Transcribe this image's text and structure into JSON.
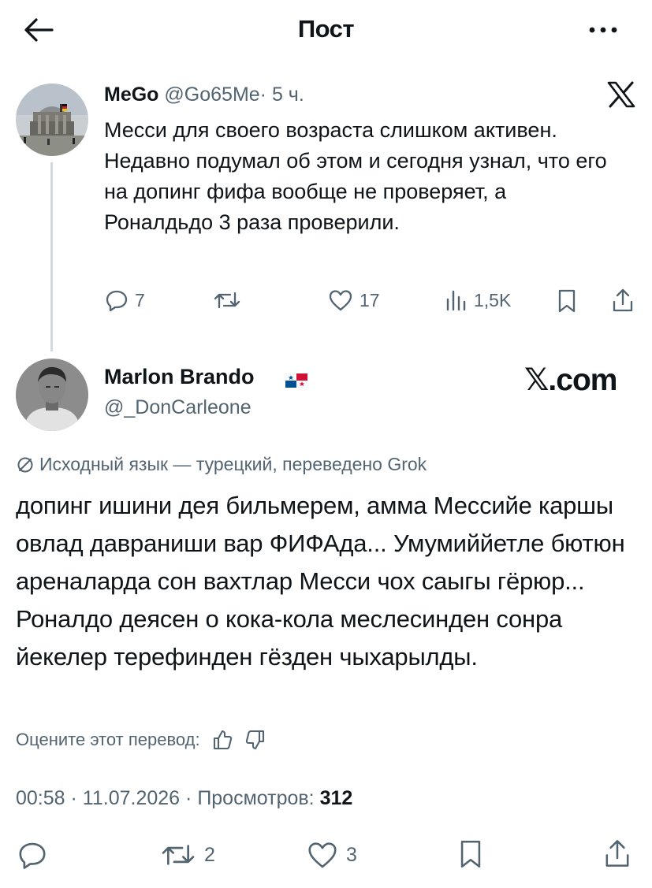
{
  "header": {
    "title": "Пост"
  },
  "parent_tweet": {
    "name": "MeGo",
    "handle": "@Go65Me",
    "separator": "·",
    "time": "5 ч.",
    "text": "Месси для своего возраста слишком активен. Недавно подумал об этом и сегодня узнал, что его на допинг фифа вообще не проверяет, а Роналдьдо 3 раза проверили.",
    "actions": {
      "replies": "7",
      "reposts": "",
      "likes": "17",
      "views": "1,5K"
    },
    "brand_icon": "x-logo-icon"
  },
  "quoted_tweet": {
    "name": "Marlon Brando",
    "flag": "panama-flag",
    "handle": "@_DonCarleone",
    "brand": "𝕏.com",
    "translation_note": "Исходный язык — турецкий, переведено Grok",
    "text": "допинг ишини дея бильмерем, амма Мессийе каршы овлад давраниши вар ФИФАда... Умумиййетле бютюн ареналарда сон вахтлар Месси чох саыгы гёрюр... Роналдо деясен о кока-кола меслесинден сонра йекелер терефинден гёзден чыхарылды.",
    "rate_label": "Оцените этот перевод:",
    "meta": {
      "time": "00:58",
      "dot": "·",
      "date": "11.07.2026",
      "views_label": "Просмотров:",
      "views": "312"
    },
    "actions": {
      "replies": "",
      "reposts": "2",
      "likes": "3"
    }
  },
  "colors": {
    "muted": "#536471",
    "text": "#0f1419",
    "divider": "#cfd9de"
  }
}
